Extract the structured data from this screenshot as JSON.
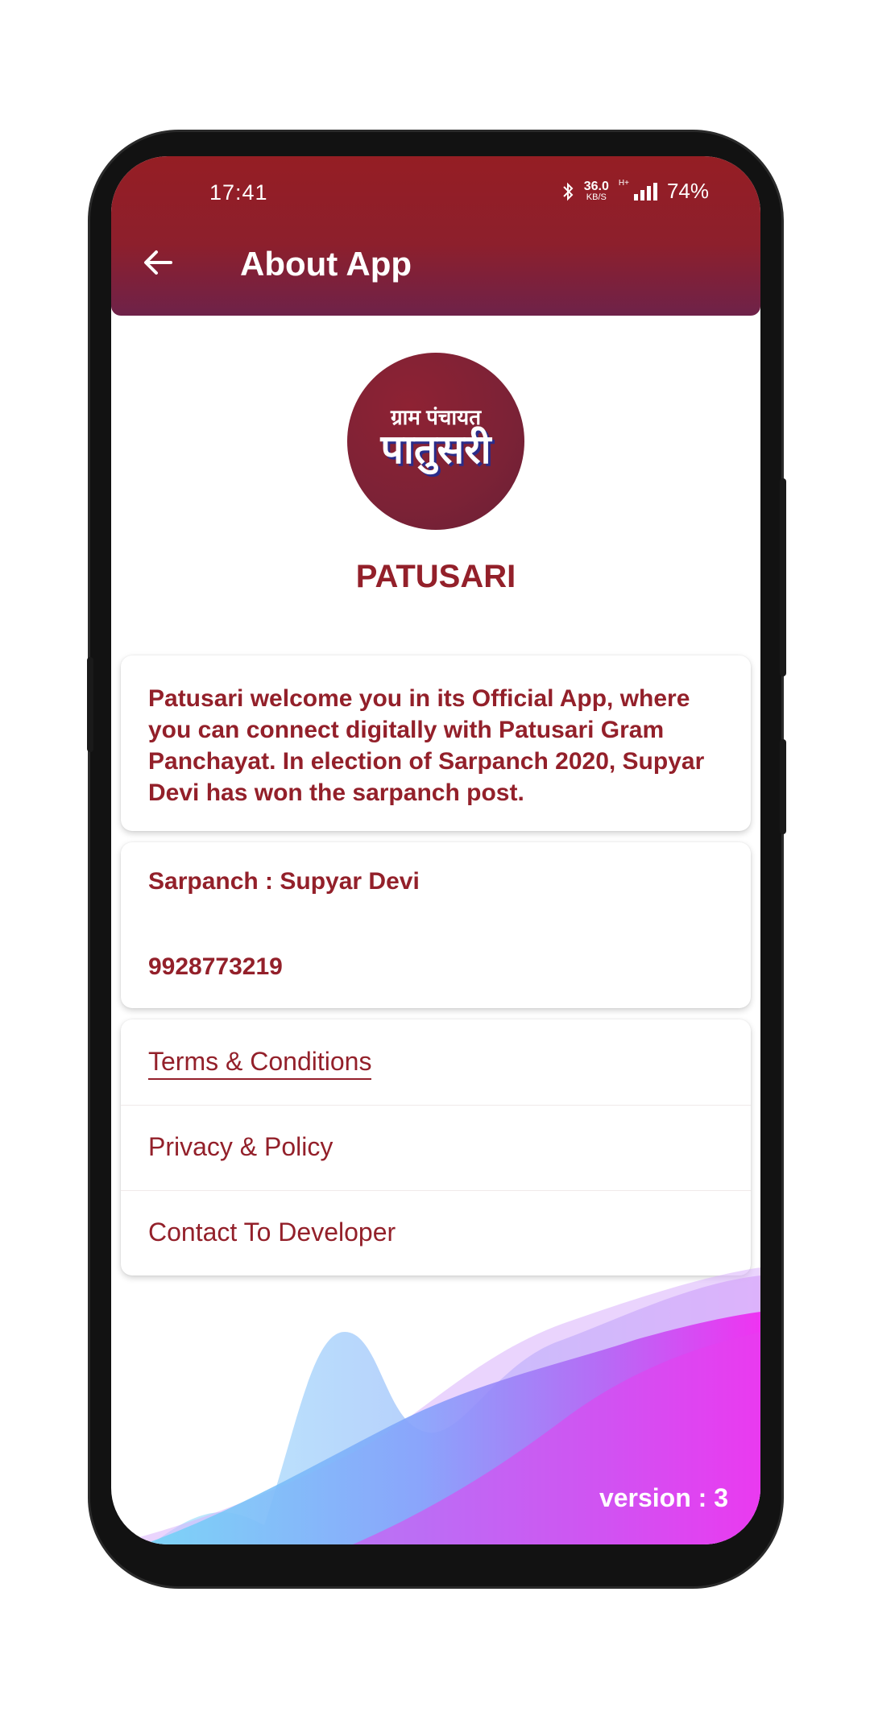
{
  "status_bar": {
    "time": "17:41",
    "net_speed_value": "36.0",
    "net_speed_unit": "KB/S",
    "network_type": "H+",
    "battery": "74%"
  },
  "appbar": {
    "title": "About App"
  },
  "logo": {
    "line1": "ग्राम पंचायत",
    "line2": "पातुसरी"
  },
  "app_name": "PATUSARI",
  "intro_text": "Patusari welcome you in its Official App, where you can connect digitally with Patusari Gram Panchayat. In election of Sarpanch 2020, Supyar Devi has won the sarpanch post.",
  "contact": {
    "sarpanch": "Sarpanch : Supyar Devi",
    "phone": "9928773219"
  },
  "links": [
    {
      "label": "Terms & Conditions"
    },
    {
      "label": "Privacy & Policy"
    },
    {
      "label": "Contact To Developer"
    }
  ],
  "version": "version : 3",
  "colors": {
    "primary": "#93202a",
    "appbar_top": "#951e24",
    "appbar_bottom": "#6e2249"
  }
}
